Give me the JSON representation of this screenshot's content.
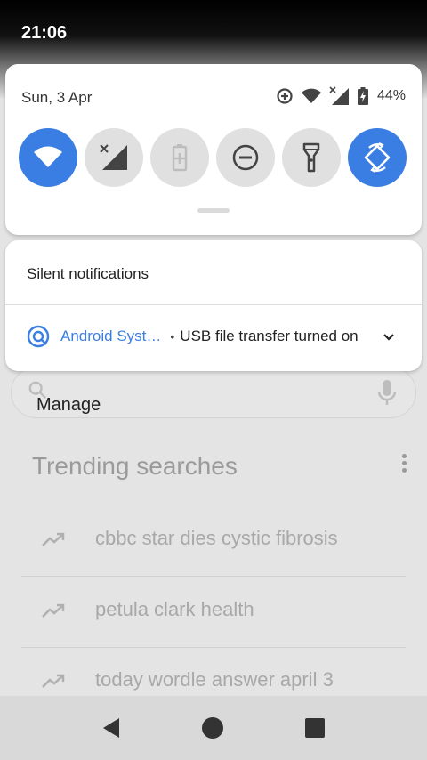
{
  "status_bar": {
    "time": "21:06"
  },
  "quick_settings": {
    "date": "Sun, 3 Apr",
    "battery_percent": "44%",
    "tiles": [
      {
        "name": "wifi",
        "active": true
      },
      {
        "name": "mobile-data",
        "active": false
      },
      {
        "name": "battery-saver",
        "active": false
      },
      {
        "name": "do-not-disturb",
        "active": false
      },
      {
        "name": "flashlight",
        "active": false
      },
      {
        "name": "auto-rotate",
        "active": true
      }
    ]
  },
  "notifications": {
    "header": "Silent notifications",
    "items": [
      {
        "app": "Android Syst…",
        "text": "USB file transfer turned on"
      }
    ],
    "manage_label": "Manage"
  },
  "background_app": {
    "trending_title": "Trending searches",
    "trends": [
      "cbbc star dies cystic fibrosis",
      "petula clark health",
      "today wordle answer april 3"
    ]
  },
  "colors": {
    "accent": "#3b7ee3",
    "tile_off": "#e0e0e0"
  }
}
